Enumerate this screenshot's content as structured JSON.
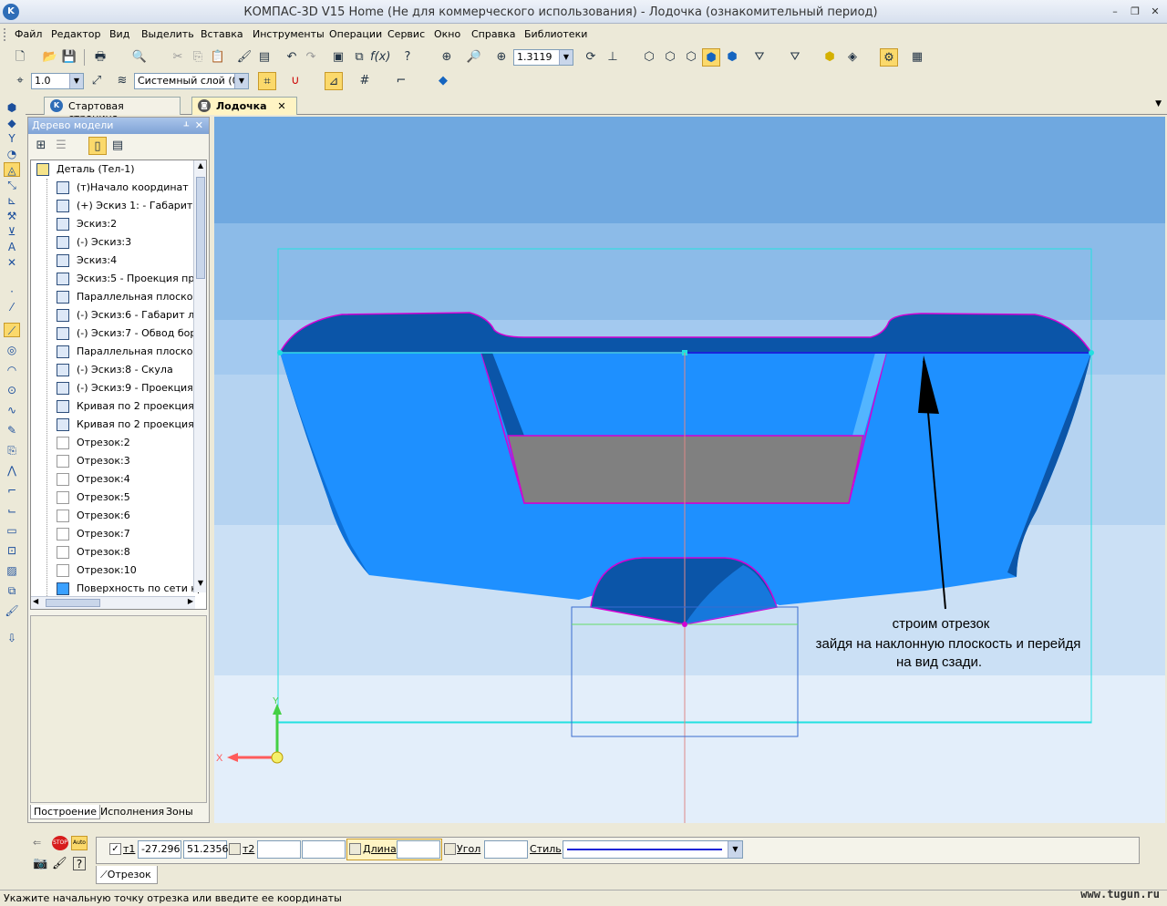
{
  "window": {
    "title": "КОМПАС-3D V15 Home (Не для коммерческого использования) - Лодочка (ознакомительный период)",
    "app_icon": "K",
    "minimize": "–",
    "restore": "❐",
    "close": "✕"
  },
  "menu": [
    "Файл",
    "Редактор",
    "Вид",
    "Выделить",
    "Вставка",
    "Инструменты",
    "Операции",
    "Сервис",
    "Окно",
    "Справка",
    "Библиотеки"
  ],
  "toolbar": {
    "zoom_value": "1.3119",
    "line_scale": "1.0",
    "layer": "Системный слой (0)"
  },
  "tabs": [
    {
      "label": "Стартовая страница",
      "icon": "kompas-icon"
    },
    {
      "label": "Лодочка",
      "icon": "part-icon",
      "close": "✕"
    }
  ],
  "tree_panel": {
    "title": "Дерево модели",
    "pin": "ᚆ",
    "close": "✕",
    "root": "Деталь (Тел-1)",
    "items": [
      "(т)Начало координат",
      "(+) Эскиз 1: - Габарит г",
      "Эскиз:2",
      "(-) Эскиз:3",
      "Эскиз:4",
      "Эскиз:5 - Проекция про,",
      "Параллельная плоскост",
      "(-) Эскиз:6 - Габарит ло",
      "(-) Эскиз:7 - Обвод бор",
      "Параллельная плоскост",
      "(-) Эскиз:8 - Скула",
      "(-) Эскиз:9 - Проекция г",
      "Кривая по 2 проекциям:",
      "Кривая по 2 проекциям:",
      "Отрезок:2",
      "Отрезок:3",
      "Отрезок:4",
      "Отрезок:5",
      "Отрезок:6",
      "Отрезок:7",
      "Отрезок:8",
      "Отрезок:10",
      "Поверхность по сети кр"
    ],
    "bottom_tabs": [
      "Построение",
      "Исполнения",
      "Зоны"
    ]
  },
  "viewport": {
    "annotation_lines": [
      "строим отрезок",
      "зайдя на наклонную плоскость и перейдя",
      "на вид сзади."
    ],
    "axis_x": "X",
    "axis_y": "Y",
    "colors": {
      "background": "#6fa8e0",
      "hull": "#1e90ff",
      "hull_dark": "#0b55a8",
      "deck_gray": "#808080",
      "highlight": "#d400d4",
      "cyan": "#22e0e0"
    }
  },
  "properties": {
    "t1_label": "т1",
    "t1_x": "-27.296",
    "t1_y": "51.2356",
    "t2_label": "т2",
    "length_label": "Длина",
    "angle_label": "Угол",
    "style_label": "Стиль",
    "stop_label": "STOP",
    "auto_label": "Auto",
    "tab_label": "Отрезок"
  },
  "status_text": "Укажите начальную точку отрезка или введите ее координаты",
  "watermark": "www.tugun.ru"
}
